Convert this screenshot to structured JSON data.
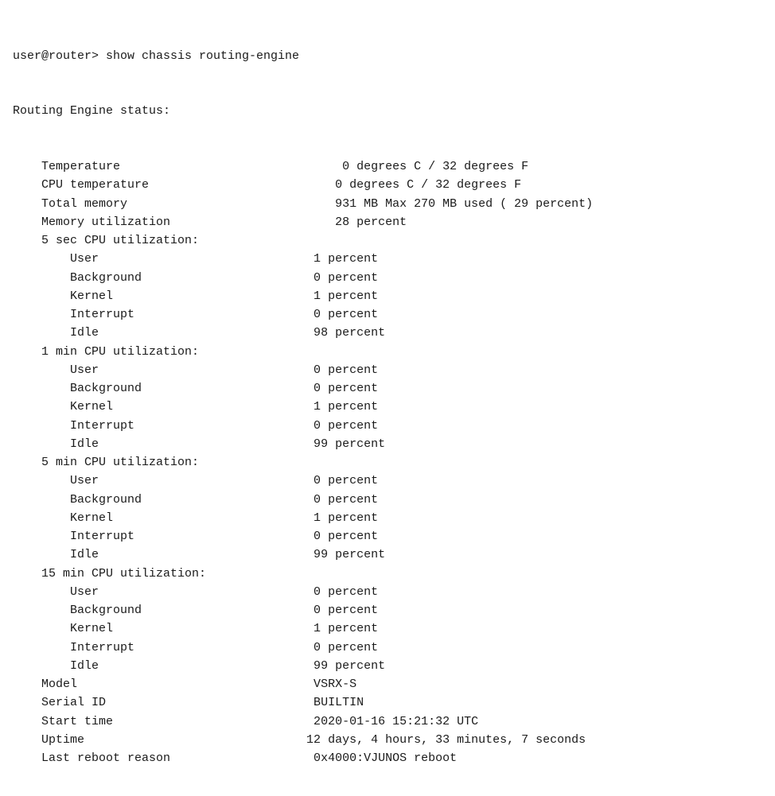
{
  "terminal": {
    "command_line": "user@router> show chassis routing-engine",
    "section_header": "Routing Engine status:",
    "rows": [
      {
        "indent": "    ",
        "label": "Temperature",
        "pad": "                               ",
        "value": "0 degrees C / 32 degrees F"
      },
      {
        "indent": "    ",
        "label": "CPU temperature",
        "pad": "                          ",
        "value": "0 degrees C / 32 degrees F"
      },
      {
        "indent": "    ",
        "label": "Total memory",
        "pad": "                             ",
        "value": "931 MB Max 270 MB used ( 29 percent)"
      },
      {
        "indent": "    ",
        "label": "Memory utilization",
        "pad": "                       ",
        "value": "28 percent"
      },
      {
        "indent": "    ",
        "label": "5 sec CPU utilization:",
        "pad": "",
        "value": ""
      },
      {
        "indent": "        ",
        "label": "User",
        "pad": "                              ",
        "value": "1 percent"
      },
      {
        "indent": "        ",
        "label": "Background",
        "pad": "                        ",
        "value": "0 percent"
      },
      {
        "indent": "        ",
        "label": "Kernel",
        "pad": "                            ",
        "value": "1 percent"
      },
      {
        "indent": "        ",
        "label": "Interrupt",
        "pad": "                         ",
        "value": "0 percent"
      },
      {
        "indent": "        ",
        "label": "Idle",
        "pad": "                              ",
        "value": "98 percent"
      },
      {
        "indent": "    ",
        "label": "1 min CPU utilization:",
        "pad": "",
        "value": ""
      },
      {
        "indent": "        ",
        "label": "User",
        "pad": "                              ",
        "value": "0 percent"
      },
      {
        "indent": "        ",
        "label": "Background",
        "pad": "                        ",
        "value": "0 percent"
      },
      {
        "indent": "        ",
        "label": "Kernel",
        "pad": "                            ",
        "value": "1 percent"
      },
      {
        "indent": "        ",
        "label": "Interrupt",
        "pad": "                         ",
        "value": "0 percent"
      },
      {
        "indent": "        ",
        "label": "Idle",
        "pad": "                              ",
        "value": "99 percent"
      },
      {
        "indent": "    ",
        "label": "5 min CPU utilization:",
        "pad": "",
        "value": ""
      },
      {
        "indent": "        ",
        "label": "User",
        "pad": "                              ",
        "value": "0 percent"
      },
      {
        "indent": "        ",
        "label": "Background",
        "pad": "                        ",
        "value": "0 percent"
      },
      {
        "indent": "        ",
        "label": "Kernel",
        "pad": "                            ",
        "value": "1 percent"
      },
      {
        "indent": "        ",
        "label": "Interrupt",
        "pad": "                         ",
        "value": "0 percent"
      },
      {
        "indent": "        ",
        "label": "Idle",
        "pad": "                              ",
        "value": "99 percent"
      },
      {
        "indent": "    ",
        "label": "15 min CPU utilization:",
        "pad": "",
        "value": ""
      },
      {
        "indent": "        ",
        "label": "User",
        "pad": "                              ",
        "value": "0 percent"
      },
      {
        "indent": "        ",
        "label": "Background",
        "pad": "                        ",
        "value": "0 percent"
      },
      {
        "indent": "        ",
        "label": "Kernel",
        "pad": "                            ",
        "value": "1 percent"
      },
      {
        "indent": "        ",
        "label": "Interrupt",
        "pad": "                         ",
        "value": "0 percent"
      },
      {
        "indent": "        ",
        "label": "Idle",
        "pad": "                              ",
        "value": "99 percent"
      },
      {
        "indent": "    ",
        "label": "Model",
        "pad": "                                 ",
        "value": "VSRX-S"
      },
      {
        "indent": "    ",
        "label": "Serial ID",
        "pad": "                             ",
        "value": "BUILTIN"
      },
      {
        "indent": "    ",
        "label": "Start time",
        "pad": "                            ",
        "value": "2020-01-16 15:21:32 UTC"
      },
      {
        "indent": "    ",
        "label": "Uptime",
        "pad": "                               ",
        "value": "12 days, 4 hours, 33 minutes, 7 seconds"
      },
      {
        "indent": "    ",
        "label": "Last reboot reason",
        "pad": "                    ",
        "value": "0x4000:VJUNOS reboot"
      }
    ]
  }
}
